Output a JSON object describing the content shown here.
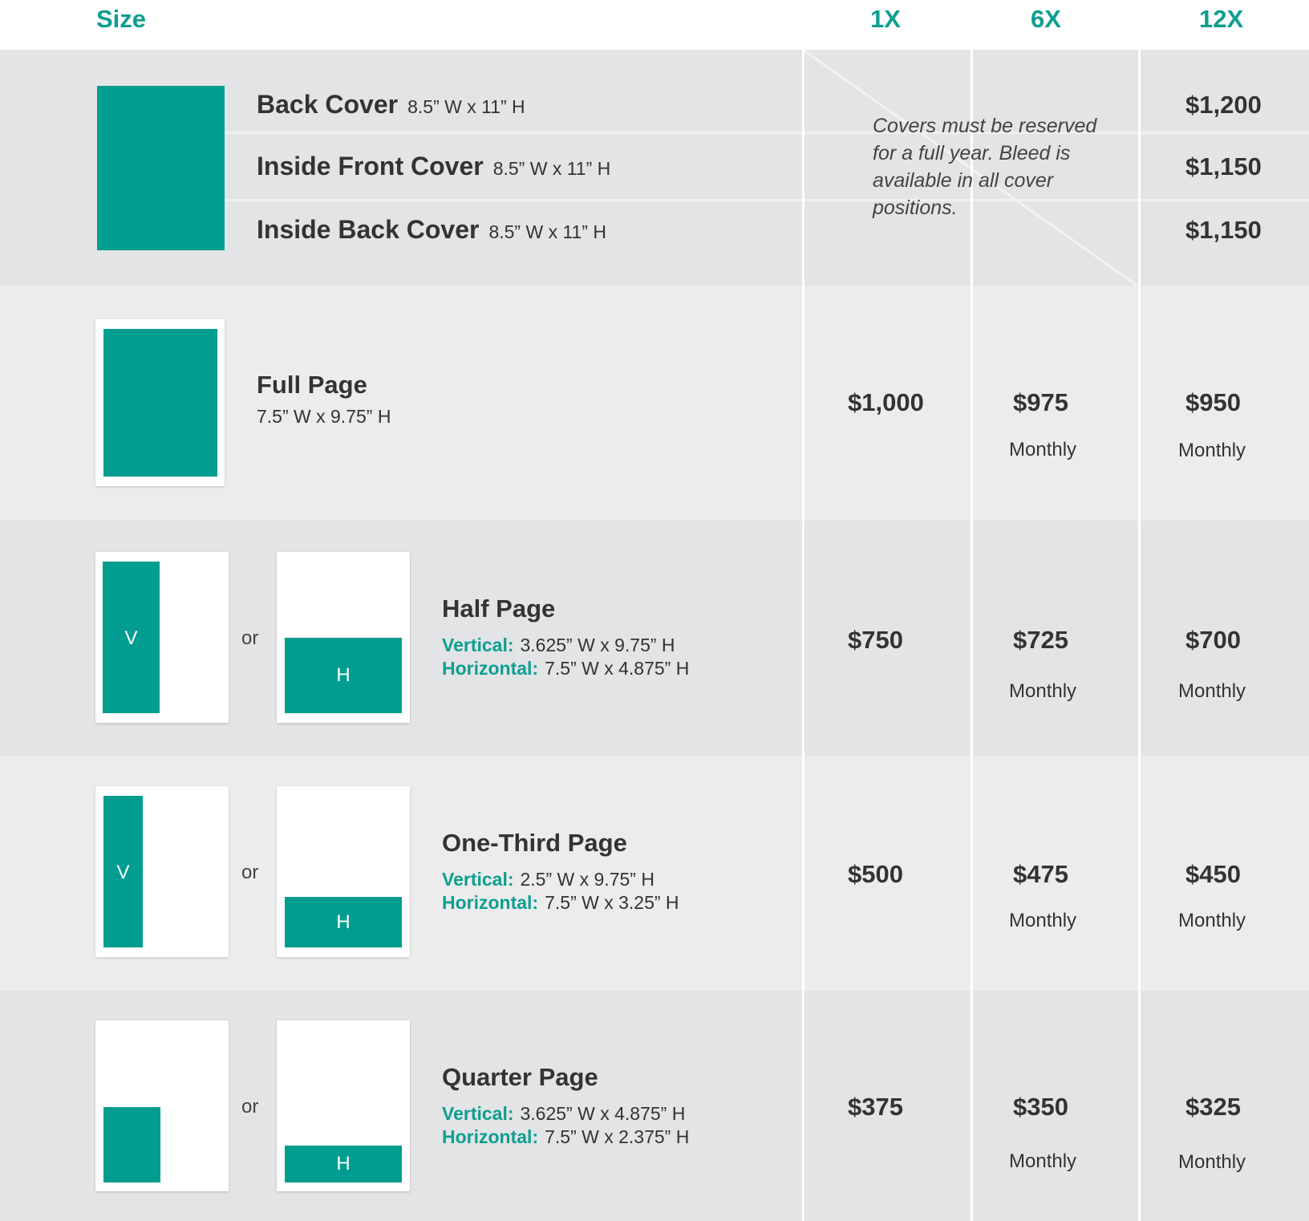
{
  "header": {
    "size": "Size",
    "col_1x": "1X",
    "col_6x": "6X",
    "col_12x": "12X"
  },
  "covers": {
    "items": [
      {
        "title": "Back Cover",
        "dims": "8.5” W x 11” H",
        "price": "$1,200"
      },
      {
        "title": "Inside Front Cover",
        "dims": "8.5” W x 11” H",
        "price": "$1,150"
      },
      {
        "title": "Inside Back Cover",
        "dims": "8.5” W x 11” H",
        "price": "$1,150"
      }
    ],
    "note": "Covers must be reserved for a full year. Bleed is available in all cover positions."
  },
  "sizes": [
    {
      "name": "Full Page",
      "dims": "7.5” W x 9.75” H",
      "price_1x": "$1,000",
      "price_6x": "$975",
      "price_12x": "$950",
      "frequency": "Monthly"
    },
    {
      "name": "Half Page",
      "vertical_label": "Vertical:",
      "vertical": "3.625” W x 9.75” H",
      "horizontal_label": "Horizontal:",
      "horizontal": "7.5” W x 4.875” H",
      "price_1x": "$750",
      "price_6x": "$725",
      "price_12x": "$700",
      "frequency": "Monthly",
      "or": "or",
      "v": "V",
      "h": "H"
    },
    {
      "name": "One-Third Page",
      "vertical_label": "Vertical:",
      "vertical": "2.5” W x 9.75” H",
      "horizontal_label": "Horizontal:",
      "horizontal": "7.5” W x 3.25” H",
      "price_1x": "$500",
      "price_6x": "$475",
      "price_12x": "$450",
      "frequency": "Monthly",
      "or": "or",
      "v": "V",
      "h": "H"
    },
    {
      "name": "Quarter Page",
      "vertical_label": "Vertical:",
      "vertical": "3.625” W x 4.875” H",
      "horizontal_label": "Horizontal:",
      "horizontal": "7.5” W x 2.375” H",
      "price_1x": "$375",
      "price_6x": "$350",
      "price_12x": "$325",
      "frequency": "Monthly",
      "or": "or",
      "h": "H"
    }
  ],
  "colors": {
    "accent": "#009d90",
    "band_dark": "#e3e4e6",
    "band_light": "#ececed",
    "text": "#333333"
  }
}
